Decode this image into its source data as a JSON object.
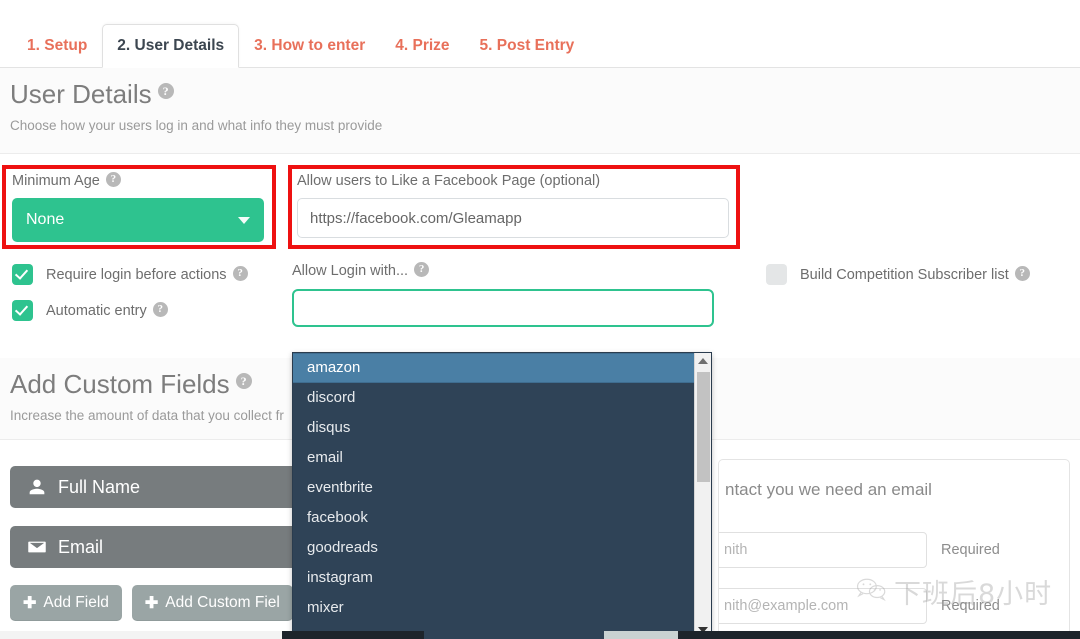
{
  "tabs": [
    {
      "label": "1. Setup",
      "active": false
    },
    {
      "label": "2. User Details",
      "active": true
    },
    {
      "label": "3. How to enter",
      "active": false
    },
    {
      "label": "4. Prize",
      "active": false
    },
    {
      "label": "5. Post Entry",
      "active": false
    }
  ],
  "sections": {
    "user_details": {
      "title": "User Details",
      "subtitle": "Choose how your users log in and what info they must provide",
      "help_icon": "help-icon"
    },
    "custom_fields": {
      "title": "Add Custom Fields",
      "subtitle": "Increase the amount of data that you collect fr",
      "help_icon": "help-icon"
    }
  },
  "min_age": {
    "label": "Minimum Age",
    "value": "None",
    "caret_icon": "chevron-down-icon"
  },
  "facebook_page": {
    "label": "Allow users to Like a Facebook Page (optional)",
    "value": "https://facebook.com/Gleamapp"
  },
  "checkboxes": [
    {
      "label": "Require login before actions",
      "checked": true
    },
    {
      "label": "Automatic entry",
      "checked": true
    },
    {
      "label": "Build Competition Subscriber list",
      "checked": false
    }
  ],
  "login_with": {
    "label": "Allow Login with...",
    "value": "",
    "options": [
      {
        "label": "amazon",
        "selected": true
      },
      {
        "label": "discord",
        "selected": false
      },
      {
        "label": "disqus",
        "selected": false
      },
      {
        "label": "email",
        "selected": false
      },
      {
        "label": "eventbrite",
        "selected": false
      },
      {
        "label": "facebook",
        "selected": false
      },
      {
        "label": "goodreads",
        "selected": false
      },
      {
        "label": "instagram",
        "selected": false
      },
      {
        "label": "mixer",
        "selected": false
      }
    ]
  },
  "custom_field_rows": [
    {
      "label": "Full Name",
      "icon": "user-icon"
    },
    {
      "label": "Email",
      "icon": "envelope-icon"
    }
  ],
  "buttons": [
    {
      "label": "Add Field",
      "icon": "plus-icon"
    },
    {
      "label": "Add Custom Fiel",
      "icon": "plus-icon"
    }
  ],
  "preview": {
    "message": "ntact you we need an email",
    "name_placeholder": "nith",
    "email_placeholder": "nith@example.com",
    "required_label_1": "Required",
    "required_label_2": "Required"
  },
  "watermark": {
    "text": "下班后8小时",
    "icon": "wechat-icon"
  },
  "colors": {
    "tab_inactive": "#e8705a",
    "tab_active": "#3c4650",
    "accent_teal": "#2ec38f",
    "dropdown_bg": "#2f4357",
    "dropdown_selected": "#4a7fa5",
    "annotation_red": "#ee1111",
    "field_row_gray": "#777c7e",
    "button_gray": "#9aa5a5"
  }
}
